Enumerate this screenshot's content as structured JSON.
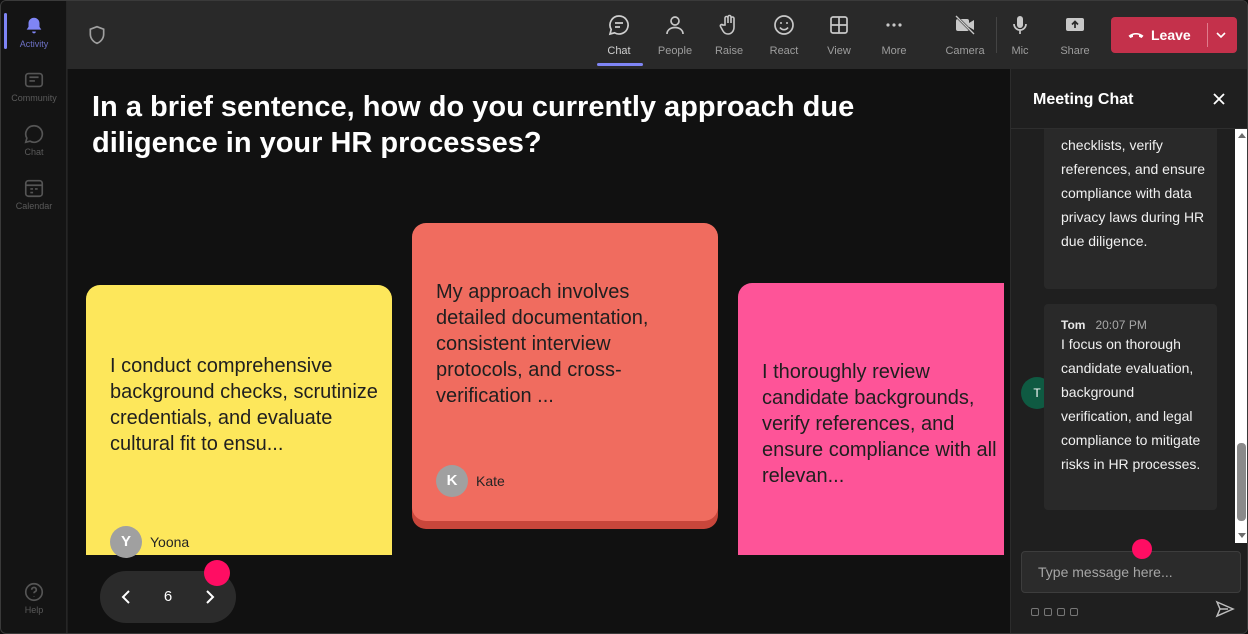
{
  "rail": {
    "items": [
      {
        "label": "Activity"
      },
      {
        "label": "Community"
      },
      {
        "label": "Chat"
      },
      {
        "label": "Calendar"
      },
      {
        "label": "Help"
      }
    ]
  },
  "toolbar": {
    "chat": "Chat",
    "people": "People",
    "raise": "Raise",
    "react": "React",
    "view": "View",
    "more": "More",
    "camera": "Camera",
    "mic": "Mic",
    "share": "Share",
    "leave": "Leave"
  },
  "stage": {
    "question": "In a brief sentence, how do you currently approach due diligence in your HR processes?",
    "notes": [
      {
        "text": "I conduct comprehensive background checks, scrutinize credentials, and evaluate cultural fit to ensu...",
        "author": "Yoona",
        "initial": "Y",
        "color": "#fde75b"
      },
      {
        "text": "My approach involves detailed documentation, consistent interview protocols, and cross-verification ...",
        "author": "Kate",
        "initial": "K",
        "color": "#f06c5f"
      },
      {
        "text": "I thoroughly review candidate backgrounds, verify references, and ensure compliance with all relevan...",
        "author": "",
        "initial": "",
        "color": "#fe5498"
      }
    ],
    "pager": {
      "page": "6"
    }
  },
  "chat": {
    "title": "Meeting Chat",
    "messages": [
      {
        "text": "checklists, verify references, and ensure compliance with data privacy laws during HR due diligence."
      },
      {
        "author": "Tom",
        "initial": "T",
        "time": "20:07 PM",
        "text": "I focus on thorough candidate evaluation, background verification, and legal compliance to mitigate risks in HR processes."
      }
    ],
    "placeholder": "Type message here..."
  },
  "colors": {
    "accent": "#7f85f5",
    "leave": "#c4314b",
    "cursor": "#ff0d63",
    "avatar_t": "#0f5a42"
  }
}
